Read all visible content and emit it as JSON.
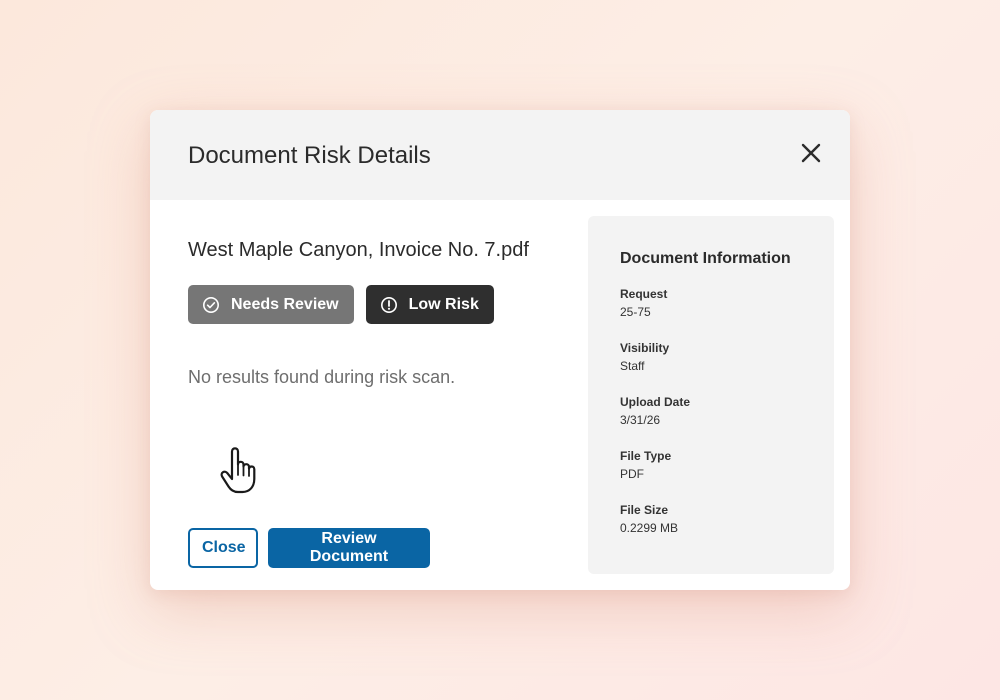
{
  "modal": {
    "title": "Document Risk Details",
    "close_icon": "close-icon"
  },
  "document": {
    "file_name": "West Maple Canyon, Invoice No. 7.pdf",
    "badges": [
      {
        "label": "Needs Review",
        "icon": "check-circle-icon",
        "color": "#767676"
      },
      {
        "label": "Low Risk",
        "icon": "alert-circle-icon",
        "color": "#2f2f2f"
      }
    ],
    "scan_result": "No results found during risk scan."
  },
  "actions": {
    "close_label": "Close",
    "review_label": "Review Document",
    "accent_color": "#0a65a4"
  },
  "info": {
    "title": "Document Information",
    "items": [
      {
        "label": "Request",
        "value": "25-75"
      },
      {
        "label": "Visibility",
        "value": "Staff"
      },
      {
        "label": "Upload Date",
        "value": "3/31/26"
      },
      {
        "label": "File Type",
        "value": "PDF"
      },
      {
        "label": "File Size",
        "value": "0.2299 MB"
      }
    ]
  }
}
